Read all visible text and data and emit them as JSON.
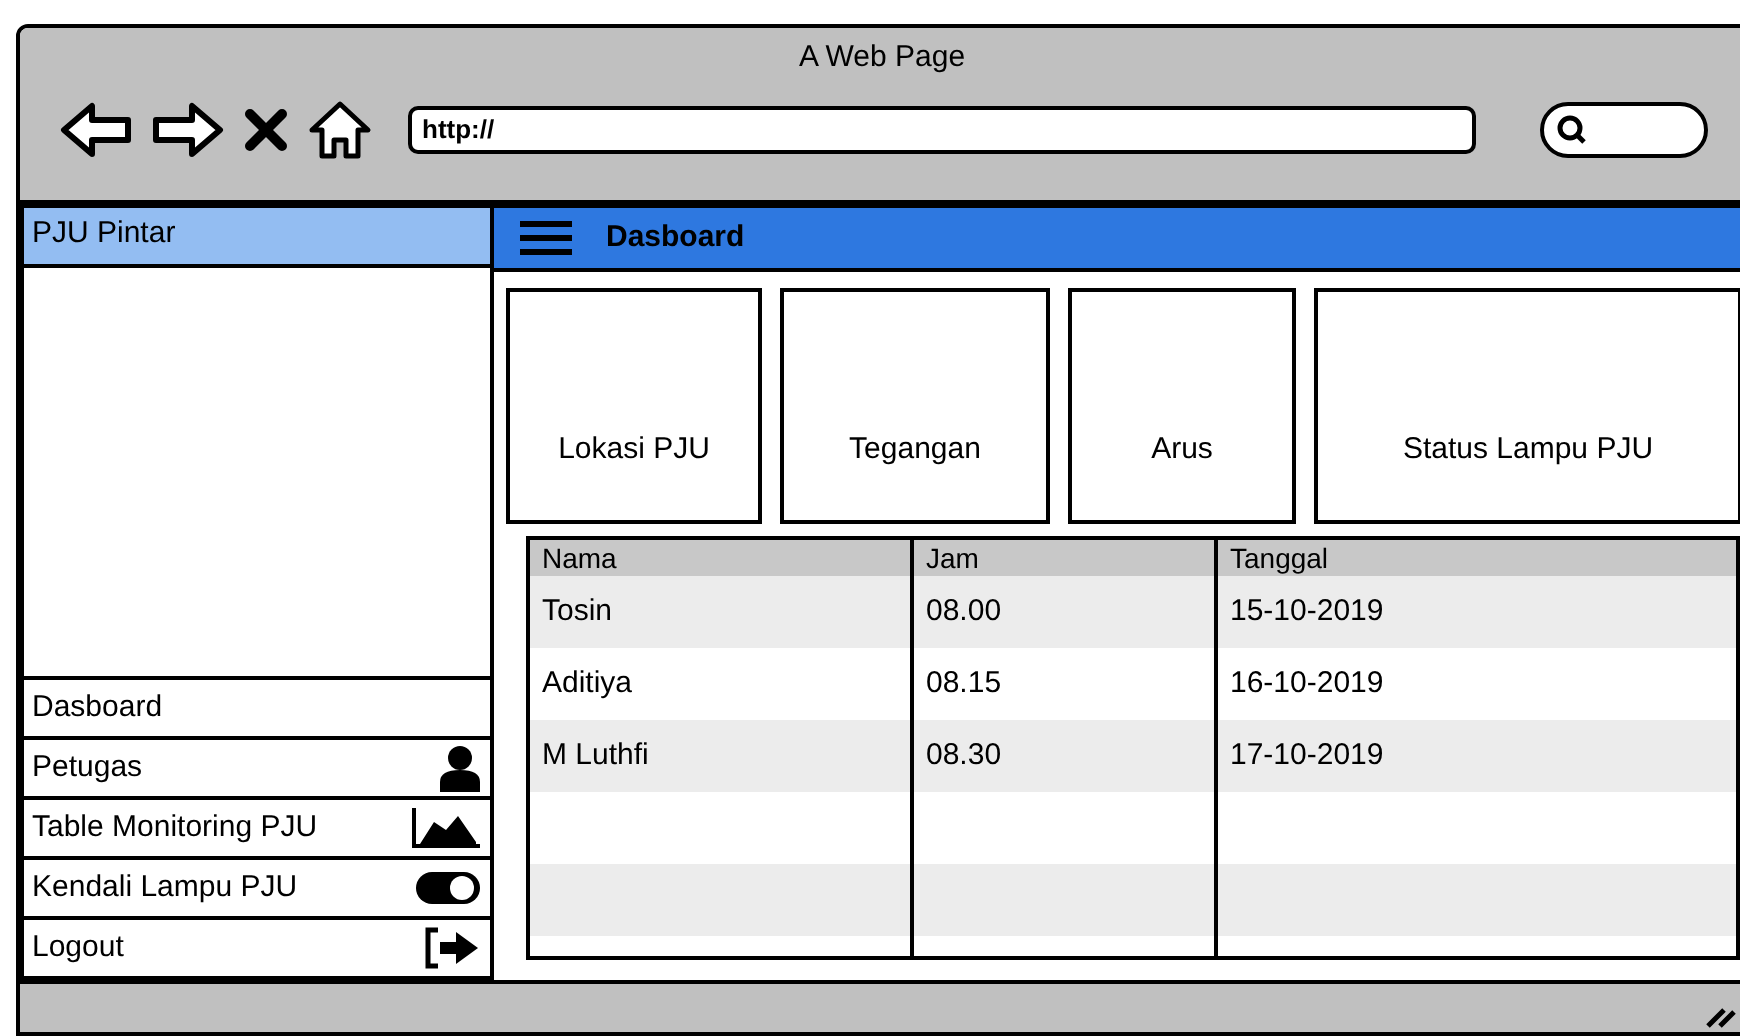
{
  "window": {
    "title": "A Web Page"
  },
  "toolbar": {
    "address": "http://"
  },
  "sidebar": {
    "title": "PJU Pintar",
    "items": [
      {
        "label": "Dasboard"
      },
      {
        "label": "Petugas"
      },
      {
        "label": "Table Monitoring PJU"
      },
      {
        "label": "Kendali Lampu PJU"
      },
      {
        "label": "Logout"
      }
    ]
  },
  "header": {
    "title": "Dasboard"
  },
  "cards": [
    {
      "label": "Lokasi PJU"
    },
    {
      "label": "Tegangan"
    },
    {
      "label": "Arus"
    },
    {
      "label": "Status Lampu PJU"
    }
  ],
  "table": {
    "columns": [
      "Nama",
      "Jam",
      "Tanggal"
    ],
    "rows": [
      [
        "Tosin",
        "08.00",
        "15-10-2019"
      ],
      [
        "Aditiya",
        "08.15",
        "16-10-2019"
      ],
      [
        "M Luthfi",
        "08.30",
        "17-10-2019"
      ]
    ]
  }
}
